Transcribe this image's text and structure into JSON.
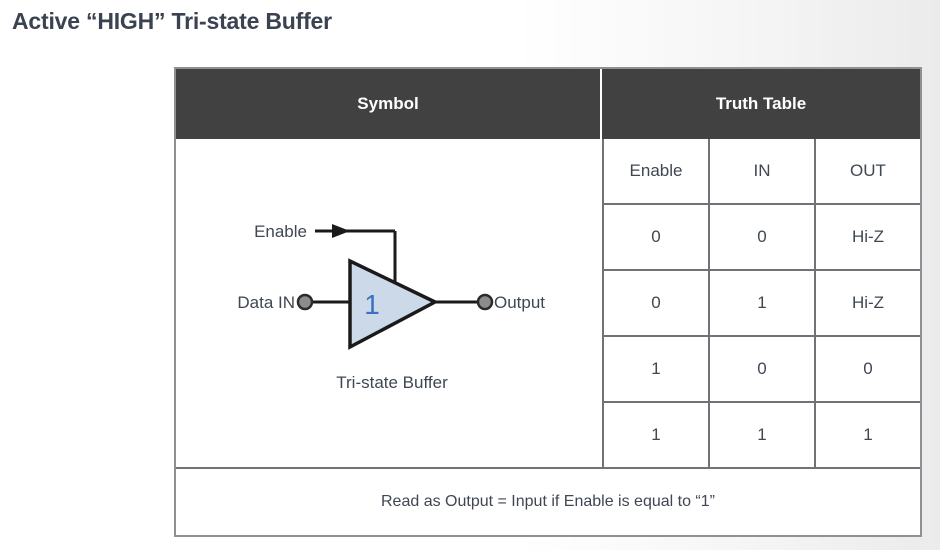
{
  "page": {
    "title": "Active “HIGH” Tri-state Buffer",
    "background_color": "#ffffff"
  },
  "table": {
    "header": {
      "symbol_label": "Symbol",
      "truth_table_label": "Truth Table",
      "background_color": "#414141",
      "text_color": "#ffffff"
    },
    "border_color": "#6f7277",
    "columns": [
      "Enable",
      "IN",
      "OUT"
    ],
    "rows": [
      [
        "0",
        "0",
        "Hi-Z"
      ],
      [
        "0",
        "1",
        "Hi-Z"
      ],
      [
        "1",
        "0",
        "0"
      ],
      [
        "1",
        "1",
        "1"
      ]
    ],
    "footer_note": "Read as Output = Input if Enable is equal to “1”"
  },
  "symbol": {
    "enable_label": "Enable",
    "data_in_label": "Data IN",
    "output_label": "Output",
    "gate_glyph": "1",
    "caption": "Tri-state Buffer",
    "gate_fill_color": "#ccd9e8",
    "gate_stroke_color": "#1a1a1a",
    "gate_glyph_color": "#3a6fc4",
    "terminal_fill_color": "#8c8c8c",
    "terminal_stroke_color": "#2b2b2b",
    "wire_color": "#1a1a1a"
  }
}
